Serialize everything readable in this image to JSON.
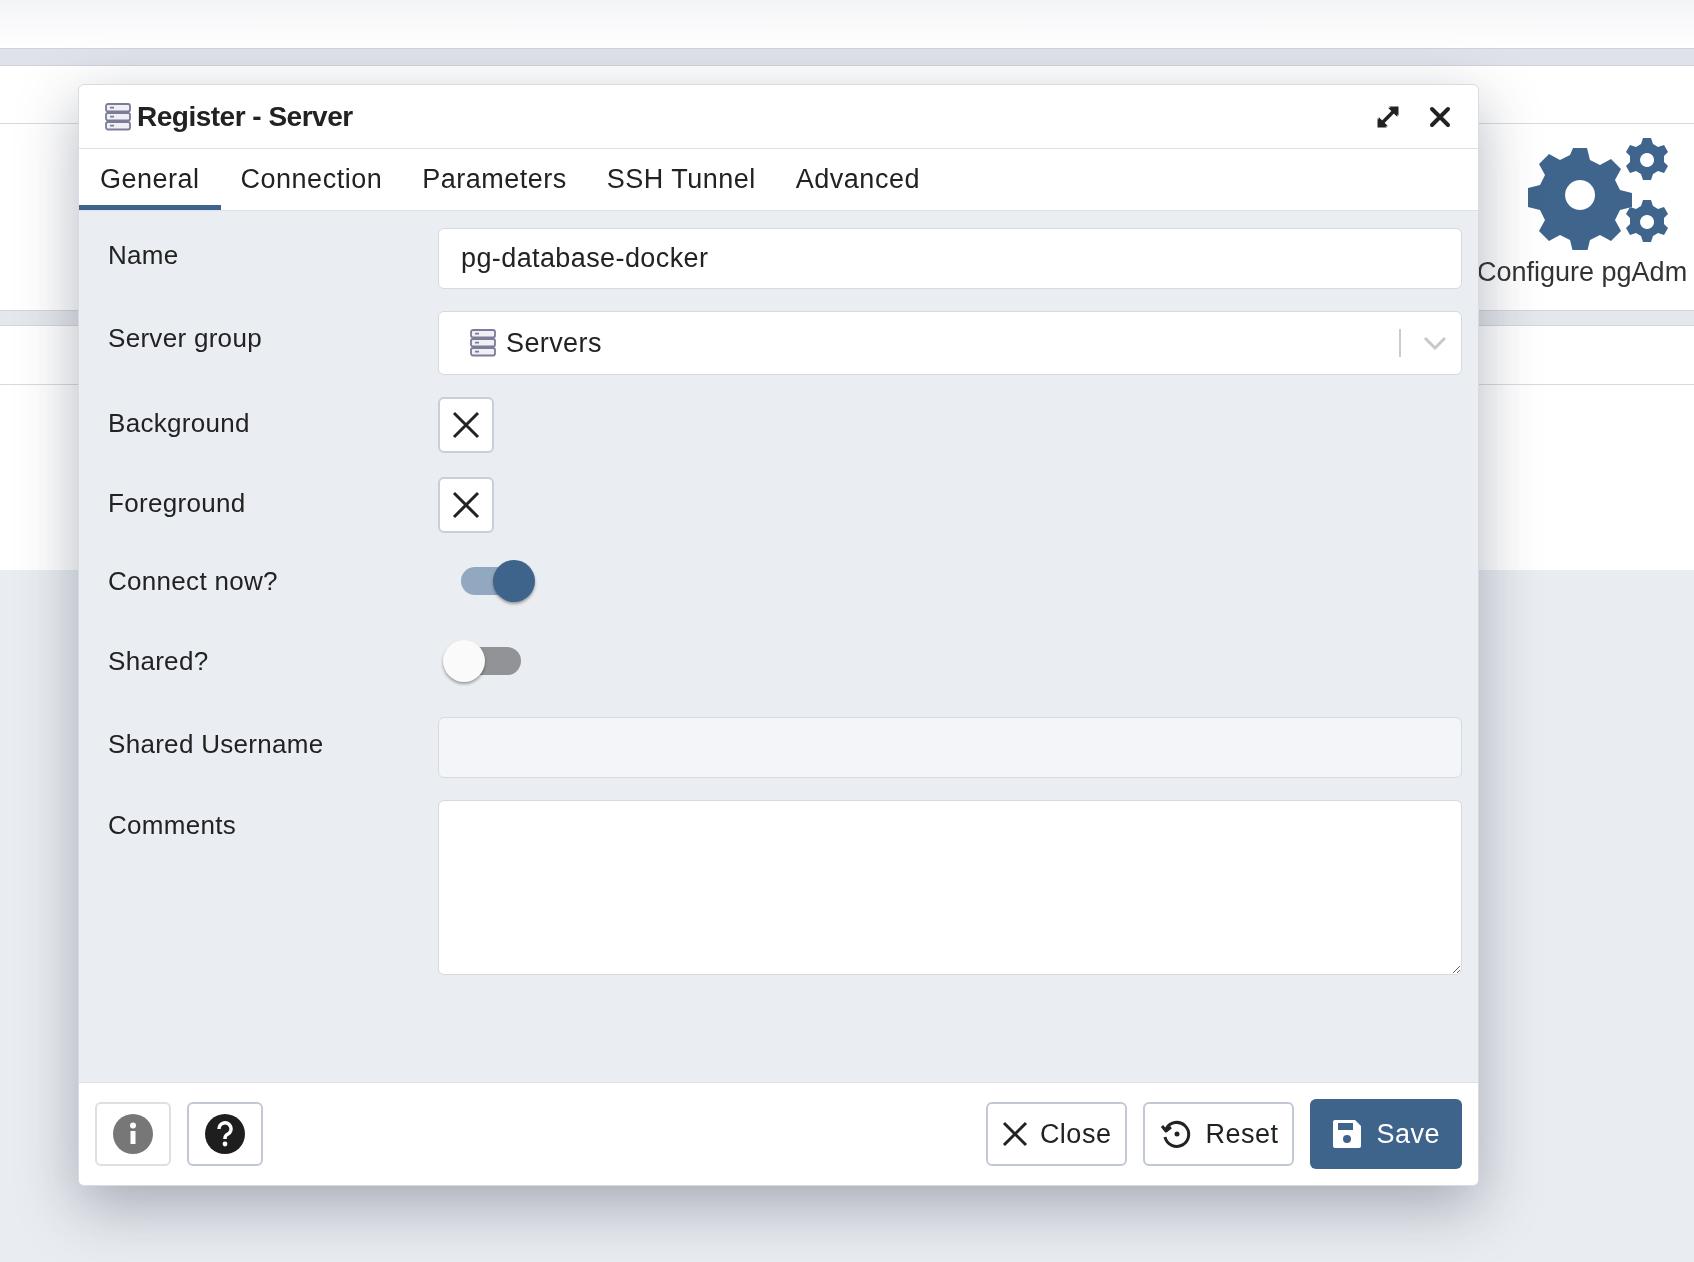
{
  "background": {
    "dashboard_card": {
      "label": "Configure pgAdm"
    }
  },
  "dialog": {
    "title": "Register - Server",
    "tabs": [
      {
        "label": "General",
        "selected": true
      },
      {
        "label": "Connection",
        "selected": false
      },
      {
        "label": "Parameters",
        "selected": false
      },
      {
        "label": "SSH Tunnel",
        "selected": false
      },
      {
        "label": "Advanced",
        "selected": false
      }
    ],
    "fields": [
      {
        "kind": "text",
        "label": "Name",
        "value": "pg-database-docker",
        "disabled": false
      },
      {
        "kind": "select",
        "label": "Server group",
        "value": "Servers"
      },
      {
        "kind": "color",
        "label": "Background"
      },
      {
        "kind": "color",
        "label": "Foreground"
      },
      {
        "kind": "switch",
        "label": "Connect now?",
        "on": true
      },
      {
        "kind": "switch",
        "label": "Shared?",
        "on": false
      },
      {
        "kind": "text",
        "label": "Shared Username",
        "disabled": true
      },
      {
        "kind": "textarea",
        "label": "Comments"
      }
    ],
    "footer_buttons": [
      {
        "kind": "close",
        "label": "Close"
      },
      {
        "kind": "reset",
        "label": "Reset"
      },
      {
        "kind": "save",
        "label": "Save"
      }
    ]
  }
}
